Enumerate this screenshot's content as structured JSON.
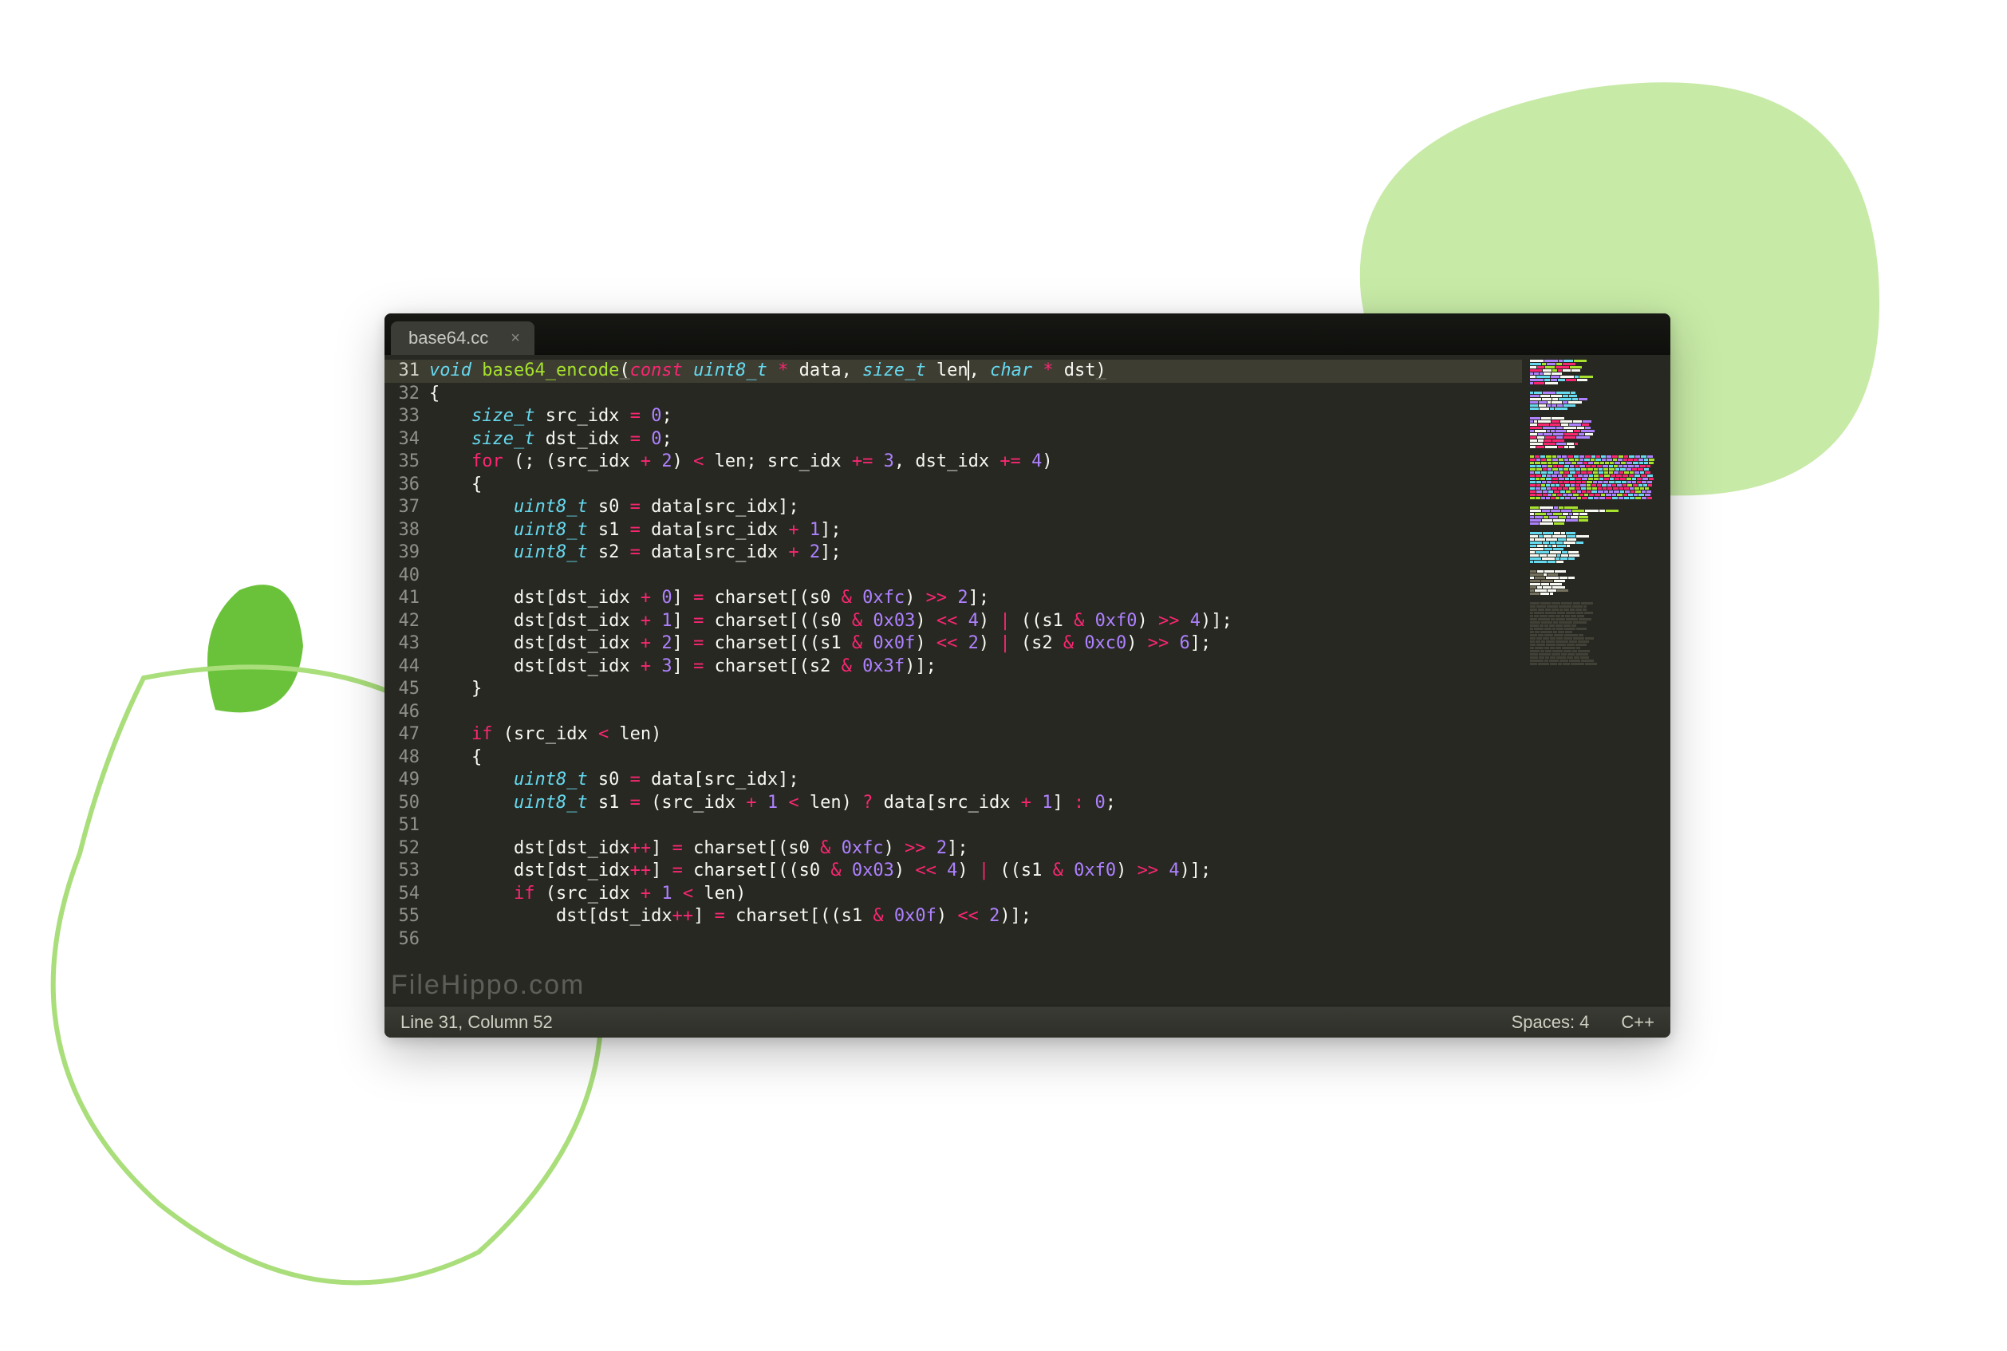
{
  "decor": {
    "blob_top_fill": "#c7eaa6",
    "blob_leaf_fill": "#6ac23a",
    "blob_outline": "#a9de7b"
  },
  "tab": {
    "title": "base64.cc"
  },
  "watermark": "FileHippo.com",
  "status": {
    "position": "Line 31, Column 52",
    "spaces": "Spaces: 4",
    "syntax": "C++"
  },
  "gutter": {
    "start": 31,
    "end": 56,
    "current": 31
  },
  "code": [
    {
      "n": 31,
      "active": true,
      "tokens": [
        [
          "ty",
          "void "
        ],
        [
          "fn",
          "base64_encode"
        ],
        [
          "pm",
          "("
        ],
        [
          "k",
          "const "
        ],
        [
          "ty",
          "uint8_t"
        ],
        [
          "id",
          " "
        ],
        [
          "op",
          "*"
        ],
        [
          "id",
          " data"
        ],
        [
          "par",
          ", "
        ],
        [
          "ty",
          "size_t"
        ],
        [
          "id",
          " len"
        ],
        [
          "caret",
          ""
        ],
        [
          "par",
          ", "
        ],
        [
          "ty",
          "char"
        ],
        [
          "id",
          " "
        ],
        [
          "op",
          "*"
        ],
        [
          "id",
          " dst"
        ],
        [
          "pm",
          ")"
        ]
      ]
    },
    {
      "n": 32,
      "tokens": [
        [
          "id",
          "{"
        ]
      ]
    },
    {
      "n": 33,
      "tokens": [
        [
          "id",
          "    "
        ],
        [
          "ty",
          "size_t"
        ],
        [
          "id",
          " src_idx "
        ],
        [
          "op",
          "="
        ],
        [
          "id",
          " "
        ],
        [
          "num",
          "0"
        ],
        [
          "id",
          ";"
        ]
      ]
    },
    {
      "n": 34,
      "tokens": [
        [
          "id",
          "    "
        ],
        [
          "ty",
          "size_t"
        ],
        [
          "id",
          " dst_idx "
        ],
        [
          "op",
          "="
        ],
        [
          "id",
          " "
        ],
        [
          "num",
          "0"
        ],
        [
          "id",
          ";"
        ]
      ]
    },
    {
      "n": 35,
      "tokens": [
        [
          "id",
          "    "
        ],
        [
          "kw",
          "for"
        ],
        [
          "id",
          " (; (src_idx "
        ],
        [
          "op",
          "+"
        ],
        [
          "id",
          " "
        ],
        [
          "num",
          "2"
        ],
        [
          "id",
          ") "
        ],
        [
          "op",
          "<"
        ],
        [
          "id",
          " len; src_idx "
        ],
        [
          "op",
          "+="
        ],
        [
          "id",
          " "
        ],
        [
          "num",
          "3"
        ],
        [
          "id",
          ", dst_idx "
        ],
        [
          "op",
          "+="
        ],
        [
          "id",
          " "
        ],
        [
          "num",
          "4"
        ],
        [
          "id",
          ")"
        ]
      ]
    },
    {
      "n": 36,
      "tokens": [
        [
          "id",
          "    {"
        ]
      ]
    },
    {
      "n": 37,
      "tokens": [
        [
          "id",
          "        "
        ],
        [
          "ty",
          "uint8_t"
        ],
        [
          "id",
          " s0 "
        ],
        [
          "op",
          "="
        ],
        [
          "id",
          " data[src_idx];"
        ]
      ]
    },
    {
      "n": 38,
      "tokens": [
        [
          "id",
          "        "
        ],
        [
          "ty",
          "uint8_t"
        ],
        [
          "id",
          " s1 "
        ],
        [
          "op",
          "="
        ],
        [
          "id",
          " data[src_idx "
        ],
        [
          "op",
          "+"
        ],
        [
          "id",
          " "
        ],
        [
          "num",
          "1"
        ],
        [
          "id",
          "];"
        ]
      ]
    },
    {
      "n": 39,
      "tokens": [
        [
          "id",
          "        "
        ],
        [
          "ty",
          "uint8_t"
        ],
        [
          "id",
          " s2 "
        ],
        [
          "op",
          "="
        ],
        [
          "id",
          " data[src_idx "
        ],
        [
          "op",
          "+"
        ],
        [
          "id",
          " "
        ],
        [
          "num",
          "2"
        ],
        [
          "id",
          "];"
        ]
      ]
    },
    {
      "n": 40,
      "tokens": [
        [
          "id",
          ""
        ]
      ]
    },
    {
      "n": 41,
      "tokens": [
        [
          "id",
          "        dst[dst_idx "
        ],
        [
          "op",
          "+"
        ],
        [
          "id",
          " "
        ],
        [
          "num",
          "0"
        ],
        [
          "id",
          "] "
        ],
        [
          "op",
          "="
        ],
        [
          "id",
          " charset[(s0 "
        ],
        [
          "op",
          "&"
        ],
        [
          "id",
          " "
        ],
        [
          "num",
          "0xfc"
        ],
        [
          "id",
          ") "
        ],
        [
          "op",
          ">>"
        ],
        [
          "id",
          " "
        ],
        [
          "num",
          "2"
        ],
        [
          "id",
          "];"
        ]
      ]
    },
    {
      "n": 42,
      "tokens": [
        [
          "id",
          "        dst[dst_idx "
        ],
        [
          "op",
          "+"
        ],
        [
          "id",
          " "
        ],
        [
          "num",
          "1"
        ],
        [
          "id",
          "] "
        ],
        [
          "op",
          "="
        ],
        [
          "id",
          " charset[((s0 "
        ],
        [
          "op",
          "&"
        ],
        [
          "id",
          " "
        ],
        [
          "num",
          "0x03"
        ],
        [
          "id",
          ") "
        ],
        [
          "op",
          "<<"
        ],
        [
          "id",
          " "
        ],
        [
          "num",
          "4"
        ],
        [
          "id",
          ") "
        ],
        [
          "op",
          "|"
        ],
        [
          "id",
          " ((s1 "
        ],
        [
          "op",
          "&"
        ],
        [
          "id",
          " "
        ],
        [
          "num",
          "0xf0"
        ],
        [
          "id",
          ") "
        ],
        [
          "op",
          ">>"
        ],
        [
          "id",
          " "
        ],
        [
          "num",
          "4"
        ],
        [
          "id",
          ")];"
        ]
      ]
    },
    {
      "n": 43,
      "tokens": [
        [
          "id",
          "        dst[dst_idx "
        ],
        [
          "op",
          "+"
        ],
        [
          "id",
          " "
        ],
        [
          "num",
          "2"
        ],
        [
          "id",
          "] "
        ],
        [
          "op",
          "="
        ],
        [
          "id",
          " charset[((s1 "
        ],
        [
          "op",
          "&"
        ],
        [
          "id",
          " "
        ],
        [
          "num",
          "0x0f"
        ],
        [
          "id",
          ") "
        ],
        [
          "op",
          "<<"
        ],
        [
          "id",
          " "
        ],
        [
          "num",
          "2"
        ],
        [
          "id",
          ") "
        ],
        [
          "op",
          "|"
        ],
        [
          "id",
          " (s2 "
        ],
        [
          "op",
          "&"
        ],
        [
          "id",
          " "
        ],
        [
          "num",
          "0xc0"
        ],
        [
          "id",
          ") "
        ],
        [
          "op",
          ">>"
        ],
        [
          "id",
          " "
        ],
        [
          "num",
          "6"
        ],
        [
          "id",
          "];"
        ]
      ]
    },
    {
      "n": 44,
      "tokens": [
        [
          "id",
          "        dst[dst_idx "
        ],
        [
          "op",
          "+"
        ],
        [
          "id",
          " "
        ],
        [
          "num",
          "3"
        ],
        [
          "id",
          "] "
        ],
        [
          "op",
          "="
        ],
        [
          "id",
          " charset[(s2 "
        ],
        [
          "op",
          "&"
        ],
        [
          "id",
          " "
        ],
        [
          "num",
          "0x3f"
        ],
        [
          "id",
          ")];"
        ]
      ]
    },
    {
      "n": 45,
      "tokens": [
        [
          "id",
          "    }"
        ]
      ]
    },
    {
      "n": 46,
      "tokens": [
        [
          "id",
          ""
        ]
      ]
    },
    {
      "n": 47,
      "tokens": [
        [
          "id",
          "    "
        ],
        [
          "kw",
          "if"
        ],
        [
          "id",
          " (src_idx "
        ],
        [
          "op",
          "<"
        ],
        [
          "id",
          " len)"
        ]
      ]
    },
    {
      "n": 48,
      "tokens": [
        [
          "id",
          "    {"
        ]
      ]
    },
    {
      "n": 49,
      "tokens": [
        [
          "id",
          "        "
        ],
        [
          "ty",
          "uint8_t"
        ],
        [
          "id",
          " s0 "
        ],
        [
          "op",
          "="
        ],
        [
          "id",
          " data[src_idx];"
        ]
      ]
    },
    {
      "n": 50,
      "tokens": [
        [
          "id",
          "        "
        ],
        [
          "ty",
          "uint8_t"
        ],
        [
          "id",
          " s1 "
        ],
        [
          "op",
          "="
        ],
        [
          "id",
          " (src_idx "
        ],
        [
          "op",
          "+"
        ],
        [
          "id",
          " "
        ],
        [
          "num",
          "1"
        ],
        [
          "id",
          " "
        ],
        [
          "op",
          "<"
        ],
        [
          "id",
          " len) "
        ],
        [
          "op",
          "?"
        ],
        [
          "id",
          " data[src_idx "
        ],
        [
          "op",
          "+"
        ],
        [
          "id",
          " "
        ],
        [
          "num",
          "1"
        ],
        [
          "id",
          "] "
        ],
        [
          "op",
          ":"
        ],
        [
          "id",
          " "
        ],
        [
          "num",
          "0"
        ],
        [
          "id",
          ";"
        ]
      ]
    },
    {
      "n": 51,
      "tokens": [
        [
          "id",
          ""
        ]
      ]
    },
    {
      "n": 52,
      "tokens": [
        [
          "id",
          "        dst[dst_idx"
        ],
        [
          "op",
          "++"
        ],
        [
          "id",
          "] "
        ],
        [
          "op",
          "="
        ],
        [
          "id",
          " charset[(s0 "
        ],
        [
          "op",
          "&"
        ],
        [
          "id",
          " "
        ],
        [
          "num",
          "0xfc"
        ],
        [
          "id",
          ") "
        ],
        [
          "op",
          ">>"
        ],
        [
          "id",
          " "
        ],
        [
          "num",
          "2"
        ],
        [
          "id",
          "];"
        ]
      ]
    },
    {
      "n": 53,
      "tokens": [
        [
          "id",
          "        dst[dst_idx"
        ],
        [
          "op",
          "++"
        ],
        [
          "id",
          "] "
        ],
        [
          "op",
          "="
        ],
        [
          "id",
          " charset[((s0 "
        ],
        [
          "op",
          "&"
        ],
        [
          "id",
          " "
        ],
        [
          "num",
          "0x03"
        ],
        [
          "id",
          ") "
        ],
        [
          "op",
          "<<"
        ],
        [
          "id",
          " "
        ],
        [
          "num",
          "4"
        ],
        [
          "id",
          ") "
        ],
        [
          "op",
          "|"
        ],
        [
          "id",
          " ((s1 "
        ],
        [
          "op",
          "&"
        ],
        [
          "id",
          " "
        ],
        [
          "num",
          "0xf0"
        ],
        [
          "id",
          ") "
        ],
        [
          "op",
          ">>"
        ],
        [
          "id",
          " "
        ],
        [
          "num",
          "4"
        ],
        [
          "id",
          ")];"
        ]
      ]
    },
    {
      "n": 54,
      "tokens": [
        [
          "id",
          "        "
        ],
        [
          "kw",
          "if"
        ],
        [
          "id",
          " (src_idx "
        ],
        [
          "op",
          "+"
        ],
        [
          "id",
          " "
        ],
        [
          "num",
          "1"
        ],
        [
          "id",
          " "
        ],
        [
          "op",
          "<"
        ],
        [
          "id",
          " len)"
        ]
      ]
    },
    {
      "n": 55,
      "tokens": [
        [
          "id",
          "            dst[dst_idx"
        ],
        [
          "op",
          "++"
        ],
        [
          "id",
          "] "
        ],
        [
          "op",
          "="
        ],
        [
          "id",
          " charset[((s1 "
        ],
        [
          "op",
          "&"
        ],
        [
          "id",
          " "
        ],
        [
          "num",
          "0x0f"
        ],
        [
          "id",
          ") "
        ],
        [
          "op",
          "<<"
        ],
        [
          "id",
          " "
        ],
        [
          "num",
          "2"
        ],
        [
          "id",
          ")];"
        ]
      ]
    },
    {
      "n": 56,
      "tokens": [
        [
          "id",
          ""
        ]
      ]
    }
  ],
  "minimap": {
    "sections": [
      {
        "rows": 8,
        "width_profile": [
          60,
          50,
          55,
          70,
          40,
          65,
          60,
          30
        ],
        "palette": [
          "#a6e22e",
          "#66d9ef",
          "#f92672",
          "#ae81ff",
          "#f8f8f2"
        ]
      },
      {
        "rows": 6,
        "width_profile": [
          55,
          60,
          70,
          68,
          50,
          40
        ],
        "palette": [
          "#f8f8f2",
          "#ae81ff",
          "#66d9ef"
        ]
      },
      {
        "rows": 10,
        "width_profile": [
          40,
          70,
          72,
          74,
          76,
          78,
          70,
          40,
          60,
          55
        ],
        "palette": [
          "#f8f8f2",
          "#ae81ff",
          "#f92672"
        ]
      },
      {
        "rows": 14,
        "width_profile": [
          150,
          150,
          150,
          150,
          150,
          150,
          150,
          150,
          150,
          150,
          150,
          150,
          150,
          150
        ],
        "palette": [
          "#ae81ff",
          "#66d9ef",
          "#f92672",
          "#a6e22e"
        ],
        "dense": true
      },
      {
        "rows": 6,
        "width_profile": [
          60,
          100,
          110,
          100,
          70,
          40
        ],
        "palette": [
          "#f8f8f2",
          "#ae81ff",
          "#a6e22e"
        ]
      },
      {
        "rows": 10,
        "width_profile": [
          50,
          60,
          55,
          65,
          70,
          40,
          60,
          55,
          50,
          40
        ],
        "palette": [
          "#f8f8f2",
          "#66d9ef"
        ]
      },
      {
        "rows": 8,
        "width_profile": [
          40,
          35,
          50,
          45,
          40,
          30,
          35,
          30
        ],
        "palette": [
          "#75715e",
          "#f8f8f2"
        ]
      },
      {
        "rows": 20,
        "width_profile": [
          70,
          70,
          70,
          70,
          70,
          70,
          70,
          70,
          70,
          70,
          70,
          70,
          70,
          70,
          70,
          70,
          70,
          70,
          70,
          70
        ],
        "palette": [
          "#75715e"
        ],
        "faint": true
      }
    ]
  }
}
